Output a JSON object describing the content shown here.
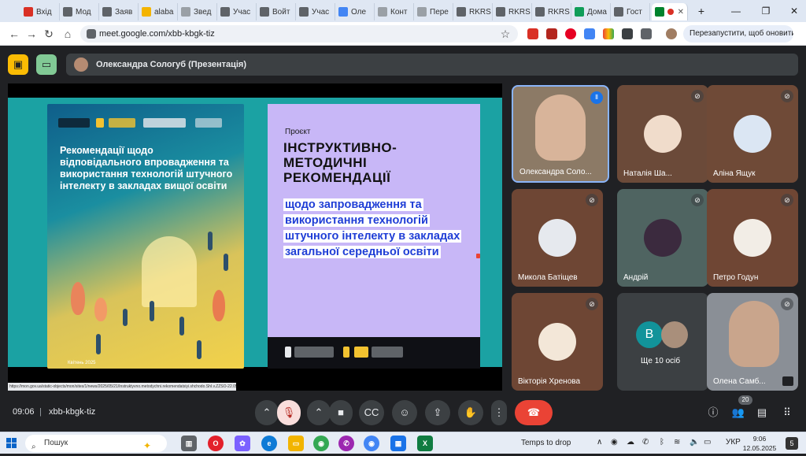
{
  "browser": {
    "tabs": [
      {
        "label": "Вхід",
        "icon": "gmail-icon",
        "color": "#d93025"
      },
      {
        "label": "Мод",
        "icon": "chrome-icon",
        "color": "#5f6368"
      },
      {
        "label": "Заяв",
        "icon": "chrome-icon",
        "color": "#5f6368"
      },
      {
        "label": "alaba",
        "icon": "grid-icon",
        "color": "#f4b400"
      },
      {
        "label": "Звед",
        "icon": "doc-icon",
        "color": "#9aa0a6"
      },
      {
        "label": "Учас",
        "icon": "chrome-icon",
        "color": "#5f6368"
      },
      {
        "label": "Войт",
        "icon": "chrome-icon",
        "color": "#5f6368"
      },
      {
        "label": "Учас",
        "icon": "chrome-icon",
        "color": "#5f6368"
      },
      {
        "label": "Оле",
        "icon": "google-icon",
        "color": "#4285f4"
      },
      {
        "label": "Конт",
        "icon": "doc-icon",
        "color": "#9aa0a6"
      },
      {
        "label": "Пере",
        "icon": "doc-icon",
        "color": "#9aa0a6"
      },
      {
        "label": "RKRS",
        "icon": "chrome-icon",
        "color": "#5f6368"
      },
      {
        "label": "RKRS",
        "icon": "chrome-icon",
        "color": "#5f6368"
      },
      {
        "label": "RKRS",
        "icon": "chrome-icon",
        "color": "#5f6368"
      },
      {
        "label": "Дома",
        "icon": "drive-icon",
        "color": "#0f9d58"
      },
      {
        "label": "Гост",
        "icon": "chrome-icon",
        "color": "#5f6368"
      }
    ],
    "new_tab": "+",
    "window_buttons": {
      "minimize": "—",
      "restore": "❐",
      "close": "✕"
    },
    "url": "meet.google.com/xbb-kbgk-tiz",
    "restart_label": "Перезапустити, щоб оновити дані"
  },
  "meet": {
    "presenter_label": "Олександра Сологуб (Презентація)",
    "slide": {
      "left_title": "Рекомендації щодо відповідального впровадження та використання технологій штучного інтелекту в закладах вищої освіти",
      "left_footer": "Квітень 2025",
      "right_kicker": "Проєкт",
      "right_title": "ІНСТРУКТИВНО-МЕТОДИЧНІ РЕКОМЕНДАЦІЇ",
      "right_subtitle": "щодо запровадження та використання технологій штучного інтелекту в закладах загальної середньої освіти"
    },
    "link_status": "https://mon.gov.ua/static-objects/mon/sites/1/news/2025/05/21/Instruktyvno.metodychni.rekomendatsiyi.shchodo.ShI.v.ZZSO-22.05.2025.pdf",
    "participants": [
      {
        "name": "Олександра Соло...",
        "state": "speaking",
        "bg": "#8c7a66"
      },
      {
        "name": "Наталія Ша...",
        "state": "muted",
        "bg": "#6b4a39"
      },
      {
        "name": "Аліна Ящук",
        "state": "muted",
        "bg": "#6f4a37"
      },
      {
        "name": "Микола Батіщев",
        "state": "muted",
        "bg": "#6e4634"
      },
      {
        "name": "Андрій",
        "state": "muted",
        "bg": "#4f6461"
      },
      {
        "name": "Петро Годун",
        "state": "muted",
        "bg": "#6f4634"
      },
      {
        "name": "Вікторія Хренова",
        "state": "muted",
        "bg": "#6e4634"
      },
      {
        "name": "Ще 10 осіб",
        "state": "more",
        "bg": "#3c4043",
        "letter": "В"
      },
      {
        "name": "Олена Самб...",
        "state": "muted",
        "bg": "#8a8f96"
      }
    ],
    "bottom": {
      "time": "09:06",
      "separator": "|",
      "meeting_code": "xbb-kbgk-tiz",
      "people_count": "20"
    }
  },
  "taskbar": {
    "search_placeholder": "Пошук",
    "weather": "Temps to drop",
    "language": "УКР",
    "time": "9:06",
    "date": "12.05.2025",
    "notifications": "5"
  }
}
